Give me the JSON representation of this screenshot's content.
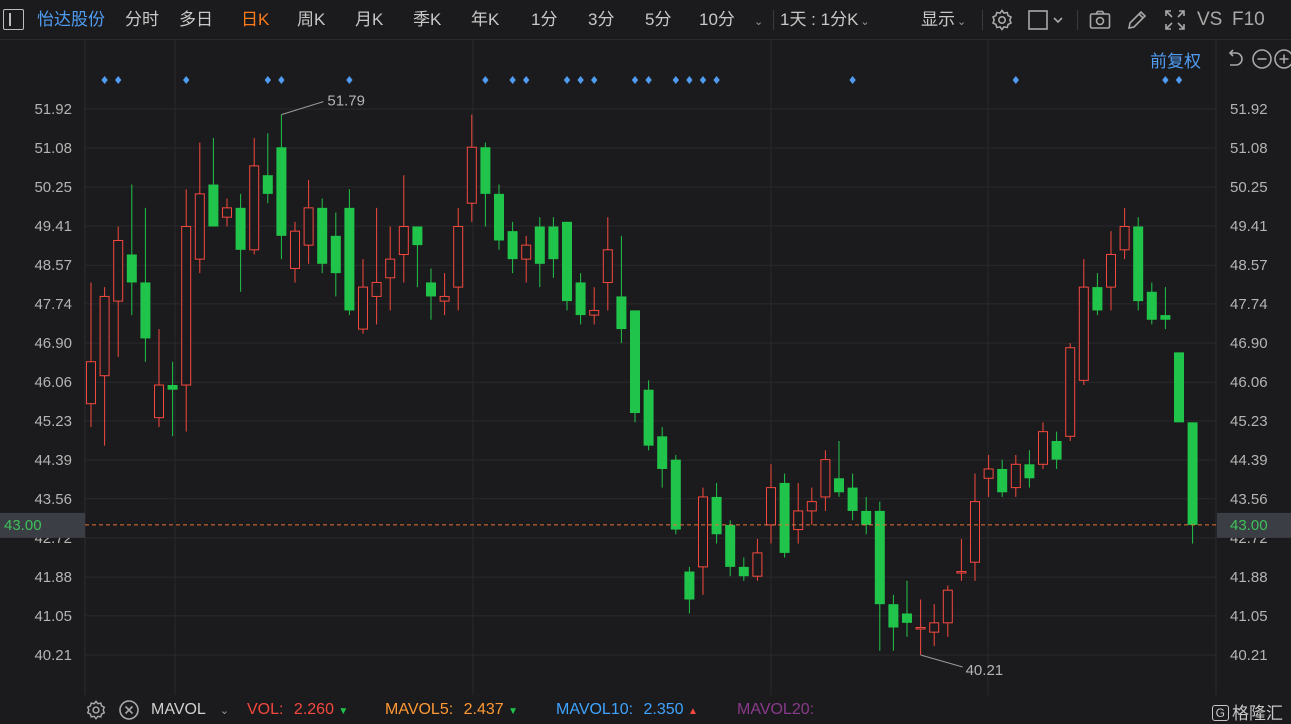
{
  "toolbar": {
    "stock_name": "怡达股份",
    "periods": [
      "分时",
      "多日",
      "日K",
      "周K",
      "月K",
      "季K",
      "年K",
      "1分",
      "3分",
      "5分",
      "10分"
    ],
    "active_period": "日K",
    "interval": "1天 : 1分K",
    "display": "显示",
    "vs": "VS",
    "f10": "F10"
  },
  "subheader": {
    "adjust": "前复权"
  },
  "chart_data": {
    "type": "candlestick",
    "y_axis_ticks": [
      "51.92",
      "51.08",
      "50.25",
      "49.41",
      "48.57",
      "47.74",
      "46.90",
      "46.06",
      "45.23",
      "44.39",
      "43.56",
      "42.72",
      "41.88",
      "41.05",
      "40.21"
    ],
    "ylim": [
      40.21,
      51.92
    ],
    "current_price": "43.00",
    "high_label": "51.79",
    "low_label": "40.21",
    "up_color": "#f5483f",
    "down_color": "#21c44a",
    "candles": [
      {
        "o": 45.6,
        "c": 46.5,
        "h": 48.2,
        "l": 45.1
      },
      {
        "o": 46.2,
        "c": 47.9,
        "h": 48.1,
        "l": 44.7
      },
      {
        "o": 47.8,
        "c": 49.1,
        "h": 49.4,
        "l": 46.6
      },
      {
        "o": 48.8,
        "c": 48.2,
        "h": 50.3,
        "l": 47.5
      },
      {
        "o": 48.2,
        "c": 47.0,
        "h": 49.8,
        "l": 46.5
      },
      {
        "o": 45.3,
        "c": 46.0,
        "h": 47.2,
        "l": 45.1
      },
      {
        "o": 46.0,
        "c": 45.9,
        "h": 46.5,
        "l": 44.9
      },
      {
        "o": 46.0,
        "c": 49.4,
        "h": 50.2,
        "l": 45.0
      },
      {
        "o": 48.7,
        "c": 50.1,
        "h": 51.2,
        "l": 48.4
      },
      {
        "o": 50.3,
        "c": 49.4,
        "h": 51.3,
        "l": 49.4
      },
      {
        "o": 49.6,
        "c": 49.8,
        "h": 50.0,
        "l": 49.4
      },
      {
        "o": 49.8,
        "c": 48.9,
        "h": 50.1,
        "l": 48.0
      },
      {
        "o": 48.9,
        "c": 50.7,
        "h": 51.3,
        "l": 48.8
      },
      {
        "o": 50.5,
        "c": 50.1,
        "h": 51.4,
        "l": 49.9
      },
      {
        "o": 51.1,
        "c": 49.2,
        "h": 51.8,
        "l": 48.7
      },
      {
        "o": 48.5,
        "c": 49.3,
        "h": 49.5,
        "l": 48.2
      },
      {
        "o": 49.0,
        "c": 49.8,
        "h": 50.4,
        "l": 48.6
      },
      {
        "o": 49.8,
        "c": 48.6,
        "h": 50.0,
        "l": 48.4
      },
      {
        "o": 49.2,
        "c": 48.4,
        "h": 49.7,
        "l": 47.9
      },
      {
        "o": 49.8,
        "c": 47.6,
        "h": 50.2,
        "l": 47.5
      },
      {
        "o": 47.2,
        "c": 48.1,
        "h": 48.7,
        "l": 47.1
      },
      {
        "o": 47.9,
        "c": 48.2,
        "h": 49.8,
        "l": 47.3
      },
      {
        "o": 48.3,
        "c": 48.7,
        "h": 49.4,
        "l": 47.6
      },
      {
        "o": 48.8,
        "c": 49.4,
        "h": 50.5,
        "l": 48.2
      },
      {
        "o": 49.4,
        "c": 49.0,
        "h": 49.4,
        "l": 48.1
      },
      {
        "o": 48.2,
        "c": 47.9,
        "h": 48.5,
        "l": 47.4
      },
      {
        "o": 47.8,
        "c": 47.9,
        "h": 48.4,
        "l": 47.5
      },
      {
        "o": 48.1,
        "c": 49.4,
        "h": 49.8,
        "l": 47.6
      },
      {
        "o": 49.9,
        "c": 51.1,
        "h": 51.8,
        "l": 49.5
      },
      {
        "o": 51.1,
        "c": 50.1,
        "h": 51.2,
        "l": 49.4
      },
      {
        "o": 50.1,
        "c": 49.1,
        "h": 50.3,
        "l": 48.9
      },
      {
        "o": 49.3,
        "c": 48.7,
        "h": 49.5,
        "l": 48.4
      },
      {
        "o": 48.7,
        "c": 49.0,
        "h": 49.2,
        "l": 48.2
      },
      {
        "o": 49.4,
        "c": 48.6,
        "h": 49.6,
        "l": 48.1
      },
      {
        "o": 49.4,
        "c": 48.7,
        "h": 49.6,
        "l": 48.3
      },
      {
        "o": 49.5,
        "c": 47.8,
        "h": 49.5,
        "l": 47.6
      },
      {
        "o": 48.2,
        "c": 47.5,
        "h": 48.4,
        "l": 47.3
      },
      {
        "o": 47.5,
        "c": 47.6,
        "h": 48.1,
        "l": 47.3
      },
      {
        "o": 48.2,
        "c": 48.9,
        "h": 49.6,
        "l": 47.6
      },
      {
        "o": 47.9,
        "c": 47.2,
        "h": 49.2,
        "l": 46.9
      },
      {
        "o": 47.6,
        "c": 45.4,
        "h": 47.6,
        "l": 45.2
      },
      {
        "o": 45.9,
        "c": 44.7,
        "h": 46.1,
        "l": 44.6
      },
      {
        "o": 44.9,
        "c": 44.2,
        "h": 45.1,
        "l": 43.8
      },
      {
        "o": 44.4,
        "c": 42.9,
        "h": 44.5,
        "l": 42.8
      },
      {
        "o": 42.0,
        "c": 41.4,
        "h": 42.1,
        "l": 41.1
      },
      {
        "o": 42.1,
        "c": 43.6,
        "h": 43.8,
        "l": 41.5
      },
      {
        "o": 43.6,
        "c": 42.8,
        "h": 43.9,
        "l": 42.6
      },
      {
        "o": 43.0,
        "c": 42.1,
        "h": 43.1,
        "l": 41.9
      },
      {
        "o": 42.1,
        "c": 41.9,
        "h": 42.3,
        "l": 41.8
      },
      {
        "o": 41.9,
        "c": 42.4,
        "h": 42.7,
        "l": 41.8
      },
      {
        "o": 43.0,
        "c": 43.8,
        "h": 44.3,
        "l": 42.6
      },
      {
        "o": 43.9,
        "c": 42.4,
        "h": 44.1,
        "l": 42.3
      },
      {
        "o": 42.9,
        "c": 43.3,
        "h": 43.9,
        "l": 42.6
      },
      {
        "o": 43.3,
        "c": 43.5,
        "h": 43.8,
        "l": 43.0
      },
      {
        "o": 43.6,
        "c": 44.4,
        "h": 44.6,
        "l": 43.3
      },
      {
        "o": 44.0,
        "c": 43.7,
        "h": 44.8,
        "l": 43.6
      },
      {
        "o": 43.8,
        "c": 43.3,
        "h": 44.1,
        "l": 43.1
      },
      {
        "o": 43.3,
        "c": 43.0,
        "h": 43.6,
        "l": 42.8
      },
      {
        "o": 43.3,
        "c": 41.3,
        "h": 43.5,
        "l": 40.3
      },
      {
        "o": 41.3,
        "c": 40.8,
        "h": 41.5,
        "l": 40.3
      },
      {
        "o": 41.1,
        "c": 40.9,
        "h": 41.8,
        "l": 40.6
      },
      {
        "o": 40.8,
        "c": 40.8,
        "h": 41.4,
        "l": 40.21
      },
      {
        "o": 40.7,
        "c": 40.9,
        "h": 41.3,
        "l": 40.4
      },
      {
        "o": 40.9,
        "c": 41.6,
        "h": 41.7,
        "l": 40.6
      },
      {
        "o": 42.0,
        "c": 42.0,
        "h": 42.7,
        "l": 41.8
      },
      {
        "o": 42.2,
        "c": 43.5,
        "h": 44.1,
        "l": 41.8
      },
      {
        "o": 44.0,
        "c": 44.2,
        "h": 44.5,
        "l": 43.6
      },
      {
        "o": 44.2,
        "c": 43.7,
        "h": 44.4,
        "l": 43.6
      },
      {
        "o": 43.8,
        "c": 44.3,
        "h": 44.5,
        "l": 43.6
      },
      {
        "o": 44.3,
        "c": 44.0,
        "h": 44.6,
        "l": 43.8
      },
      {
        "o": 44.3,
        "c": 45.0,
        "h": 45.2,
        "l": 44.2
      },
      {
        "o": 44.8,
        "c": 44.4,
        "h": 45.0,
        "l": 44.2
      },
      {
        "o": 44.9,
        "c": 46.8,
        "h": 46.9,
        "l": 44.8
      },
      {
        "o": 46.1,
        "c": 48.1,
        "h": 48.7,
        "l": 46.0
      },
      {
        "o": 48.1,
        "c": 47.6,
        "h": 48.4,
        "l": 47.5
      },
      {
        "o": 48.1,
        "c": 48.8,
        "h": 49.3,
        "l": 47.6
      },
      {
        "o": 48.9,
        "c": 49.4,
        "h": 49.8,
        "l": 48.7
      },
      {
        "o": 49.4,
        "c": 47.8,
        "h": 49.6,
        "l": 47.6
      },
      {
        "o": 48.0,
        "c": 47.4,
        "h": 48.2,
        "l": 47.3
      },
      {
        "o": 47.5,
        "c": 47.4,
        "h": 48.1,
        "l": 47.2
      },
      {
        "o": 46.7,
        "c": 45.2,
        "h": 46.7,
        "l": 45.2
      },
      {
        "o": 45.2,
        "c": 43.0,
        "h": 45.2,
        "l": 42.6
      }
    ],
    "event_markers_at": [
      1,
      2,
      7,
      13,
      14,
      19,
      29,
      31,
      32,
      35,
      36,
      37,
      40,
      41,
      43,
      44,
      45,
      46,
      56,
      68,
      79,
      80
    ]
  },
  "bottombar": {
    "indicator": "MAVOL",
    "vol_label": "VOL:",
    "vol_value": "2.260",
    "mavol5_label": "MAVOL5:",
    "mavol5_value": "2.437",
    "mavol10_label": "MAVOL10:",
    "mavol10_value": "2.350",
    "mavol20_label": "MAVOL20:",
    "colors": {
      "vol": "#f5483f",
      "mavol5": "#ff9933",
      "mavol10": "#3fa3ff",
      "mavol20": "#8a3a8a"
    }
  },
  "brand": "格隆汇"
}
